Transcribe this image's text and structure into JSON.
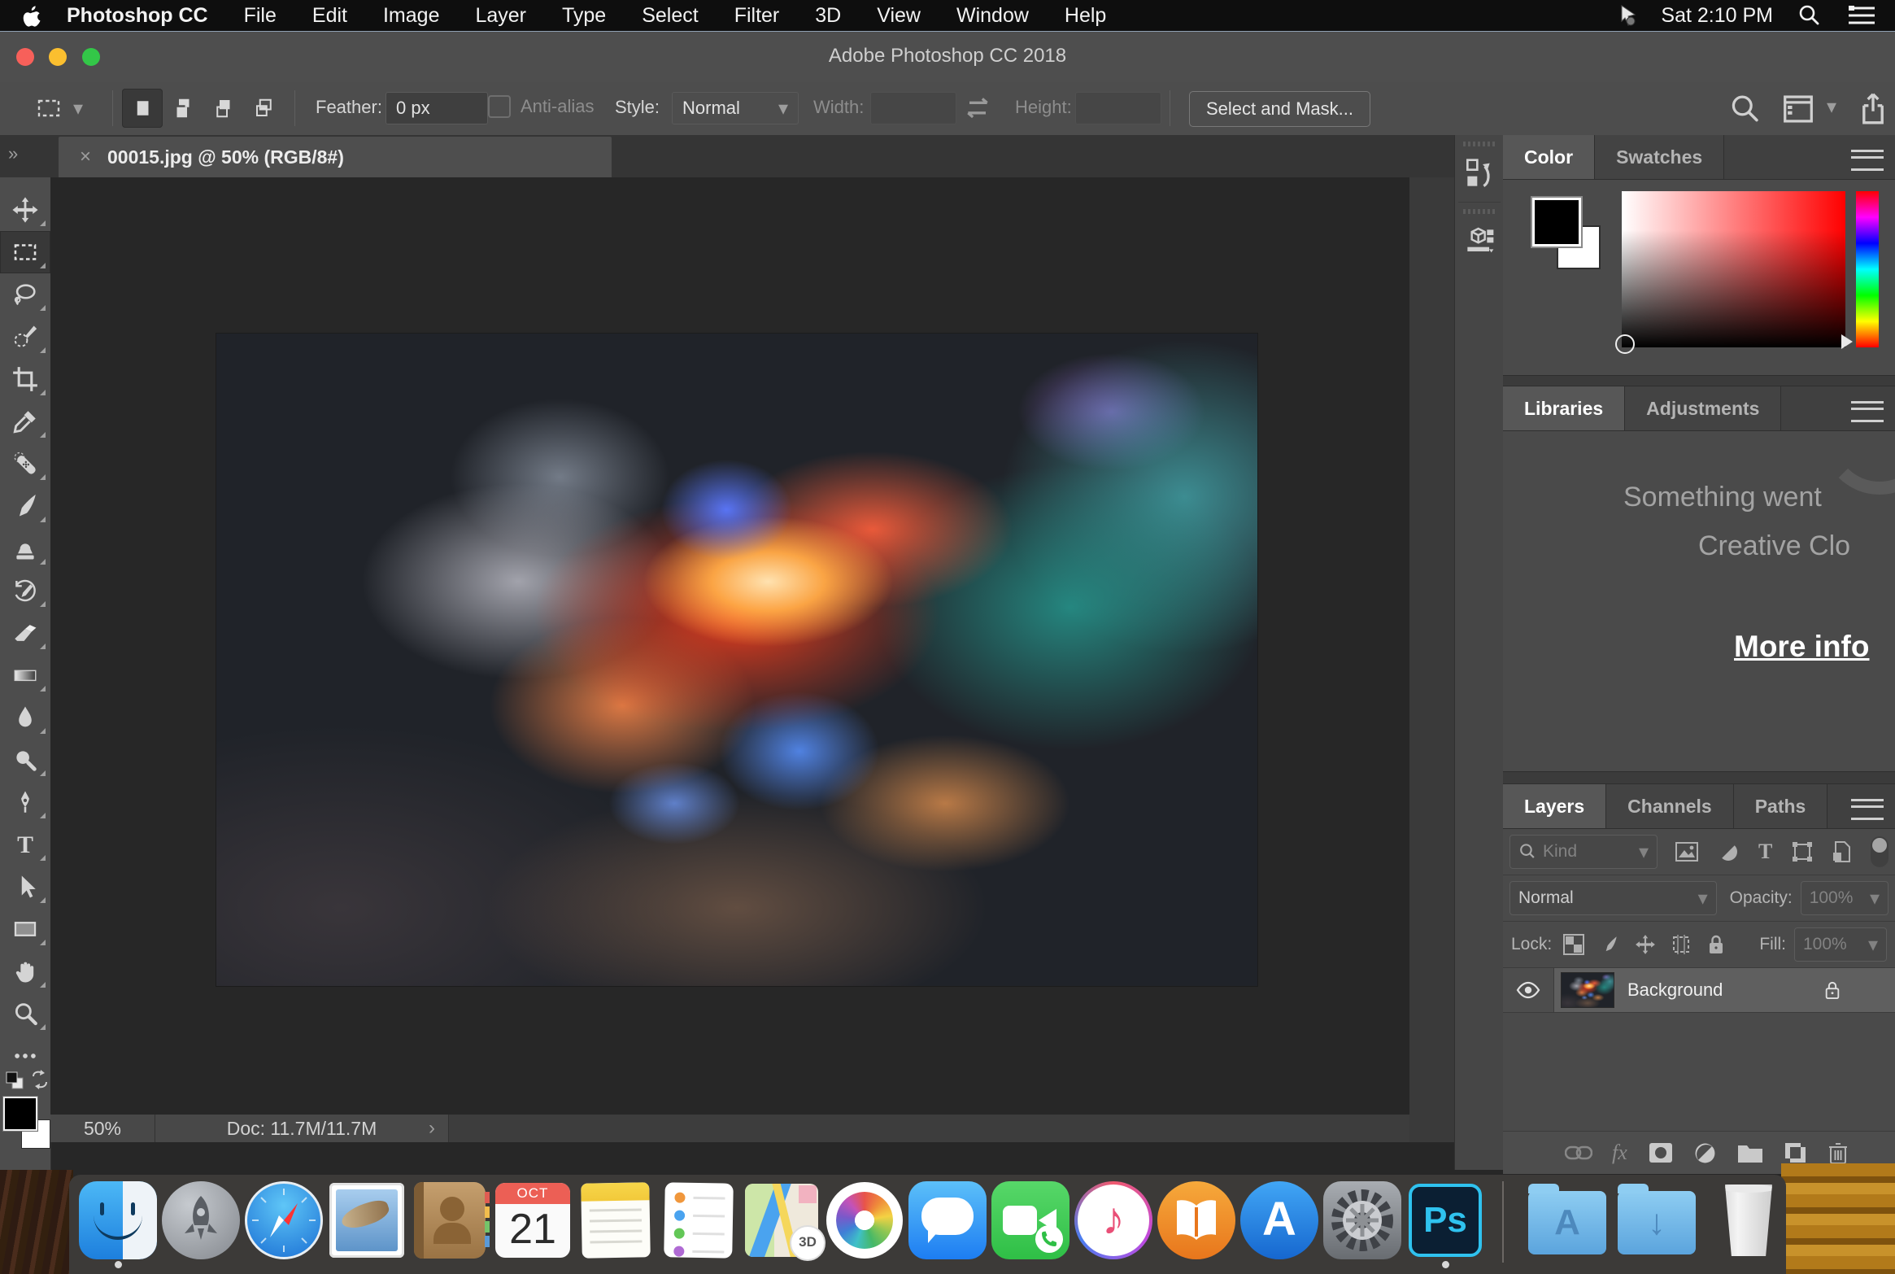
{
  "colors": {
    "menubar_bg": "#0e0e0e",
    "titlebar_bg": "#4e4e4e",
    "panel_bg": "#4d4d4d",
    "panel_content_bg": "#4a4a4a",
    "canvas_bg": "#272727",
    "dock_bg": "#3c3a38",
    "traffic_red": "#f7605a",
    "traffic_yellow": "#fbbf2f",
    "traffic_green": "#33c748",
    "selected_layer_bg": "#5f5f5f",
    "folder_blue": "#8ecdf2",
    "ps_cyan": "#2fc2ef"
  },
  "menu_bar": {
    "app_name": "Photoshop CC",
    "items": [
      "File",
      "Edit",
      "Image",
      "Layer",
      "Type",
      "Select",
      "Filter",
      "3D",
      "View",
      "Window",
      "Help"
    ],
    "clock": "Sat 2:10 PM"
  },
  "window": {
    "title": "Adobe Photoshop CC 2018"
  },
  "options_bar": {
    "feather_label": "Feather:",
    "feather_value": "0 px",
    "anti_alias_label": "Anti-alias",
    "style_label": "Style:",
    "style_value": "Normal",
    "width_label": "Width:",
    "width_value": "",
    "height_label": "Height:",
    "height_value": "",
    "select_and_mask_label": "Select and Mask..."
  },
  "document_tab": {
    "close_glyph": "×",
    "title": "00015.jpg @ 50% (RGB/8#)"
  },
  "toolbar": {
    "tools": [
      "move",
      "rectangular-marquee",
      "lasso",
      "quick-selection",
      "crop",
      "eyedropper",
      "spot-healing",
      "brush",
      "clone-stamp",
      "history-brush",
      "eraser",
      "gradient",
      "blur",
      "dodge",
      "pen",
      "type",
      "path-selection",
      "rectangle-shape",
      "hand",
      "zoom",
      "more-options"
    ],
    "active_tool": "rectangular-marquee",
    "foreground_color": "#000000",
    "background_color": "#ffffff"
  },
  "status_bar": {
    "zoom_value": "50%",
    "doc_info": "Doc: 11.7M/11.7M",
    "chevron": "›"
  },
  "color_panel": {
    "tabs": [
      "Color",
      "Swatches"
    ],
    "active_tab": "Color"
  },
  "libraries_panel": {
    "tabs": [
      "Libraries",
      "Adjustments"
    ],
    "active_tab": "Libraries",
    "message_line1": "Something went",
    "message_line2": "Creative Clo",
    "link_label": "More info"
  },
  "layers_panel": {
    "tabs": [
      "Layers",
      "Channels",
      "Paths"
    ],
    "active_tab": "Layers",
    "kind_label": "Kind",
    "filter_icons": [
      "pixel-layer",
      "adjustment-layer",
      "type-layer",
      "shape-layer",
      "smart-object"
    ],
    "blend_mode": "Normal",
    "opacity_label": "Opacity:",
    "opacity_value": "100%",
    "lock_label": "Lock:",
    "lock_icons": [
      "lock-transparency",
      "lock-pixels",
      "lock-position",
      "lock-artboard",
      "lock-all"
    ],
    "fill_label": "Fill:",
    "fill_value": "100%",
    "fx_label": "fx",
    "layers": [
      {
        "name": "Background",
        "visible": true,
        "locked": true
      }
    ],
    "footer_icons": [
      "link",
      "fx",
      "layer-mask",
      "adjustment",
      "group",
      "new-layer",
      "delete"
    ]
  },
  "dock": {
    "items": [
      "finder",
      "launchpad",
      "safari",
      "mail",
      "contacts",
      "calendar",
      "notes",
      "reminders",
      "maps",
      "photos",
      "messages",
      "facetime",
      "itunes",
      "books",
      "app-store",
      "system-preferences",
      "photoshop"
    ],
    "calendar_month": "OCT",
    "calendar_day": "21",
    "maps_badge": "3D",
    "photoshop_label": "Ps",
    "running_apps": [
      "finder",
      "photoshop"
    ],
    "folders": [
      "applications",
      "downloads"
    ],
    "trash": "trash"
  }
}
